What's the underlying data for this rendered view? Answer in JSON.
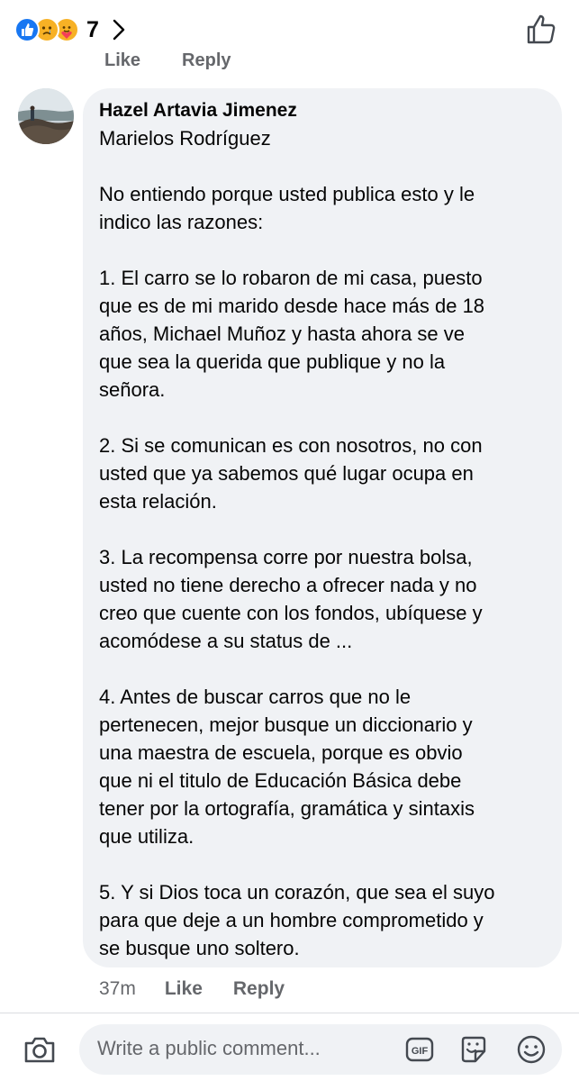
{
  "header": {
    "reaction_icons": [
      "like-icon",
      "sad-face-icon",
      "care-face-icon"
    ],
    "reaction_count": "7",
    "colors": {
      "like": "#1877f2",
      "emoji": "#f7b125"
    }
  },
  "previous_comment_actions": [
    "Like",
    "Reply"
  ],
  "comment": {
    "author": "Hazel Artavia Jimenez",
    "lines": [
      "Marielos Rodríguez",
      "",
      "No entiendo porque usted publica esto y le",
      "indico las razones:",
      "",
      "1. El carro se lo robaron de mi casa, puesto",
      "que es de mi marido desde hace más de 18",
      "años, Michael Muñoz y hasta ahora se ve",
      "que sea la querida que publique y no la",
      "señora.",
      "",
      "2. Si se comunican es con nosotros, no con",
      "usted que ya sabemos qué lugar ocupa en",
      "esta relación.",
      "",
      "3. La recompensa corre por nuestra bolsa,",
      "usted no tiene derecho a ofrecer nada y no",
      "creo que cuente con los fondos, ubíquese y",
      "acomódese a su status de ...",
      "",
      "4. Antes de buscar carros que no le",
      "pertenecen, mejor busque un diccionario y",
      "una maestra de escuela, porque es obvio",
      "que ni el titulo de Educación Básica debe",
      "tener por la ortografía, gramática y sintaxis",
      "que utiliza.",
      "",
      "5. Y si Dios toca un corazón, que sea el suyo",
      "para que deje a un hombre comprometido y",
      "se busque uno soltero."
    ],
    "time": "37m",
    "like_label": "Like",
    "reply_label": "Reply"
  },
  "composer": {
    "placeholder": "Write a public comment...",
    "icons": [
      "camera-icon",
      "gif-icon",
      "sticker-icon",
      "emoji-icon"
    ]
  }
}
